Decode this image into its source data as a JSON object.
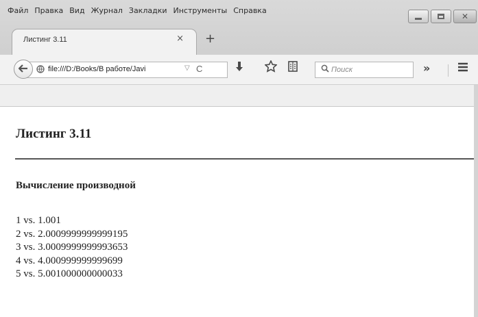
{
  "menubar": {
    "items": [
      {
        "label": "Файл"
      },
      {
        "label": "Правка"
      },
      {
        "label": "Вид"
      },
      {
        "label": "Журнал"
      },
      {
        "label": "Закладки"
      },
      {
        "label": "Инструменты"
      },
      {
        "label": "Справка"
      }
    ]
  },
  "tab": {
    "title": "Листинг 3.11",
    "close": "×",
    "new_tab": "+"
  },
  "navbar": {
    "url": "file:///D:/Books/В работе/Javi",
    "search_placeholder": "Поиск"
  },
  "icons": {
    "back": "back-arrow-icon",
    "globe": "globe-icon",
    "reload": "reload-icon",
    "download": "download-icon",
    "bookmark": "star-icon",
    "reader": "reader-icon",
    "search": "search-icon",
    "overflow": "overflow-icon",
    "menu": "hamburger-menu-icon"
  },
  "page": {
    "heading": "Листинг 3.11",
    "subheading": "Вычисление производной",
    "lines": [
      "1 vs. 1.001",
      "2 vs. 2.0009999999999195",
      "3 vs. 3.0009999999993653",
      "4 vs. 4.000999999999699",
      "5 vs. 5.001000000000033"
    ]
  }
}
